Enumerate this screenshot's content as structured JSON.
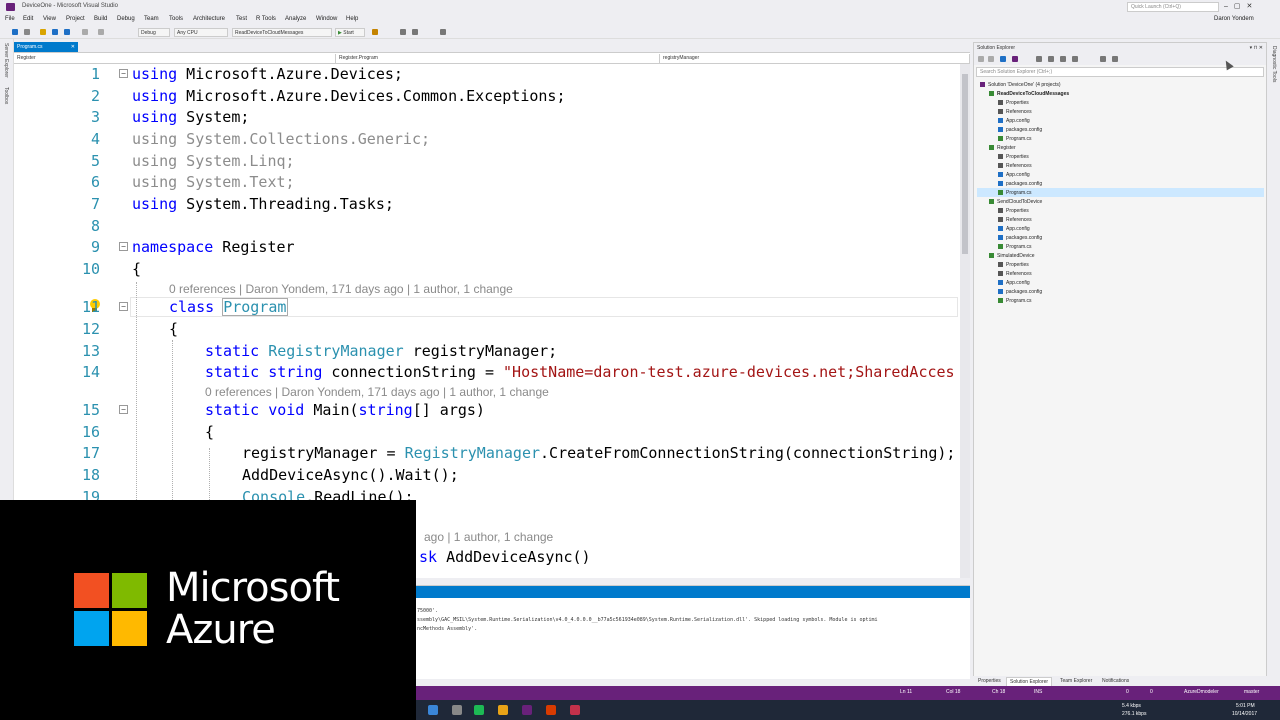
{
  "window": {
    "title": "DeviceOne - Microsoft Visual Studio",
    "quick_launch": "Quick Launch (Ctrl+Q)",
    "user": "Daron Yondem"
  },
  "menu": [
    "File",
    "Edit",
    "View",
    "Project",
    "Build",
    "Debug",
    "Team",
    "Tools",
    "Architecture",
    "Test",
    "R Tools",
    "Analyze",
    "Window",
    "Help"
  ],
  "toolbar": {
    "config": "Debug",
    "platform": "Any CPU",
    "startup_project": "ReadDeviceToCloudMessages",
    "start": "Start"
  },
  "left_tools": [
    "Server Explorer",
    "Toolbox"
  ],
  "doc_tab": "Program.cs",
  "navbar": {
    "project": "Register",
    "class": "Register.Program",
    "member": "registryManager"
  },
  "code": {
    "lines": [
      "1",
      "2",
      "3",
      "4",
      "5",
      "6",
      "7",
      "8",
      "9",
      "10",
      "11",
      "12",
      "13",
      "14",
      "15",
      "16",
      "17",
      "18",
      "19"
    ],
    "l1_kw": "using",
    "l1": " Microsoft.Azure.Devices;",
    "l2_kw": "using",
    "l2": " Microsoft.Azure.Devices.Common.Exceptions;",
    "l3_kw": "using",
    "l3": " System;",
    "l4": "using System.Collections.Generic;",
    "l5": "using System.Linq;",
    "l6": "using System.Text;",
    "l7_kw": "using",
    "l7": " System.Threading.Tasks;",
    "l9_kw": "namespace",
    "l9": " Register",
    "l10": "{",
    "lens_class": "0 references | Daron Yondem, 171 days ago | 1 author, 1 change",
    "l11_kw": "class",
    "l11_ty": "Program",
    "l12": "{",
    "l13_kw": "static",
    "l13_ty": "RegistryManager",
    "l13": " registryManager;",
    "l14_kw1": "static",
    "l14_kw2": "string",
    "l14": " connectionString = ",
    "l14_str": "\"HostName=daron-test.azure-devices.net;SharedAcces",
    "lens_main": "0 references | Daron Yondem, 171 days ago | 1 author, 1 change",
    "l15_kw1": "static",
    "l15_kw2": "void",
    "l15": " Main(",
    "l15_kw3": "string",
    "l15b": "[] args)",
    "l16": "{",
    "l17a": "registryManager = ",
    "l17_ty": "RegistryManager",
    "l17b": ".CreateFromConnectionString(connectionString);",
    "l18": "AddDeviceAsync().Wait();",
    "l19_ty": "Console",
    "l19": ".ReadLine();",
    "lens_add": "ago | 1 author, 1 change",
    "l_add_kw": "sk",
    "l_add": " AddDeviceAsync()"
  },
  "output": {
    "lines": [
      "75000'.",
      "ssembly\\GAC_MSIL\\System.Runtime.Serialization\\v4.0_4.0.0.0__b77a5c561934e089\\System.Runtime.Serialization.dll'. Skipped loading symbols. Module is optimi",
      "ncMethods Assembly'."
    ]
  },
  "solution_explorer": {
    "title": "Solution Explorer",
    "search": "Search Solution Explorer (Ctrl+;)",
    "tree": [
      {
        "label": "Solution 'DeviceOne' (4 projects)",
        "indent": 0,
        "bold": false,
        "icon": "solution"
      },
      {
        "label": "ReadDeviceToCloudMessages",
        "indent": 1,
        "bold": true,
        "icon": "project"
      },
      {
        "label": "Properties",
        "indent": 2,
        "bold": false,
        "icon": "wrench"
      },
      {
        "label": "References",
        "indent": 2,
        "bold": false,
        "icon": "refs"
      },
      {
        "label": "App.config",
        "indent": 2,
        "bold": false,
        "icon": "config"
      },
      {
        "label": "packages.config",
        "indent": 2,
        "bold": false,
        "icon": "config"
      },
      {
        "label": "Program.cs",
        "indent": 2,
        "bold": false,
        "icon": "csharp"
      },
      {
        "label": "Register",
        "indent": 1,
        "bold": false,
        "icon": "project"
      },
      {
        "label": "Properties",
        "indent": 2,
        "bold": false,
        "icon": "wrench"
      },
      {
        "label": "References",
        "indent": 2,
        "bold": false,
        "icon": "refs"
      },
      {
        "label": "App.config",
        "indent": 2,
        "bold": false,
        "icon": "config"
      },
      {
        "label": "packages.config",
        "indent": 2,
        "bold": false,
        "icon": "config"
      },
      {
        "label": "Program.cs",
        "indent": 2,
        "bold": false,
        "icon": "csharp"
      },
      {
        "label": "SendCloudToDevice",
        "indent": 1,
        "bold": false,
        "icon": "project"
      },
      {
        "label": "Properties",
        "indent": 2,
        "bold": false,
        "icon": "wrench"
      },
      {
        "label": "References",
        "indent": 2,
        "bold": false,
        "icon": "refs"
      },
      {
        "label": "App.config",
        "indent": 2,
        "bold": false,
        "icon": "config"
      },
      {
        "label": "packages.config",
        "indent": 2,
        "bold": false,
        "icon": "config"
      },
      {
        "label": "Program.cs",
        "indent": 2,
        "bold": false,
        "icon": "csharp"
      },
      {
        "label": "SimulatedDevice",
        "indent": 1,
        "bold": false,
        "icon": "project"
      },
      {
        "label": "Properties",
        "indent": 2,
        "bold": false,
        "icon": "wrench"
      },
      {
        "label": "References",
        "indent": 2,
        "bold": false,
        "icon": "refs"
      },
      {
        "label": "App.config",
        "indent": 2,
        "bold": false,
        "icon": "config"
      },
      {
        "label": "packages.config",
        "indent": 2,
        "bold": false,
        "icon": "config"
      },
      {
        "label": "Program.cs",
        "indent": 2,
        "bold": false,
        "icon": "csharp"
      }
    ],
    "tabs": [
      "Properties",
      "Solution Explorer",
      "Team Explorer",
      "Notifications"
    ]
  },
  "right_rail": "Diagnostic Tools",
  "status": {
    "ln": "Ln 11",
    "col": "Col 18",
    "ch": "Ch 18",
    "ins": "INS",
    "up": "0",
    "pencil": "0",
    "repo": "AzureDmodeler",
    "branch": "master"
  },
  "taskbar": {
    "net_up": "5.4 kbps",
    "net_down": "276.1 kbps",
    "time": "5:01 PM",
    "date": "10/14/2017"
  },
  "brand": {
    "line1": "Microsoft",
    "line2": "Azure",
    "colors": [
      "#f25022",
      "#7fba00",
      "#00a4ef",
      "#ffb900"
    ]
  },
  "colors": {
    "accent": "#007acc",
    "status_bar": "#68217a",
    "keyword": "#0000ff",
    "type": "#2b91af",
    "string": "#a31515"
  }
}
